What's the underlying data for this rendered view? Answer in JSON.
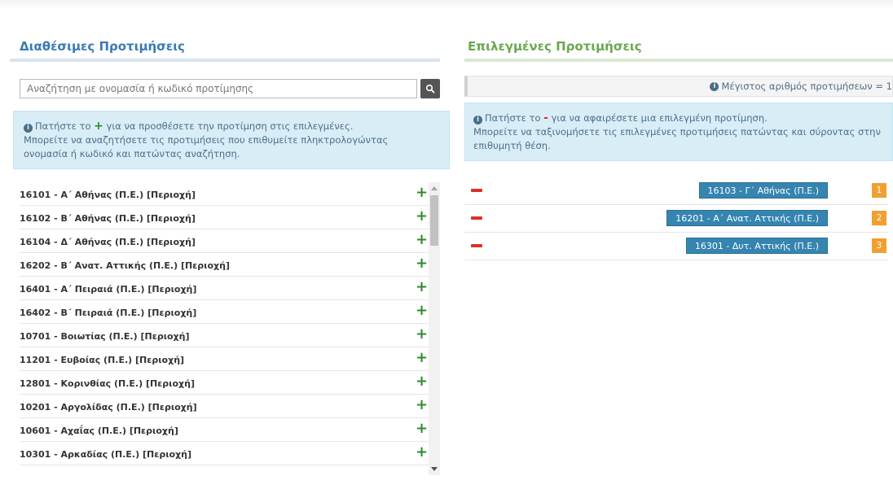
{
  "available": {
    "title": "Διαθέσιμες Προτιμήσεις",
    "search_placeholder": "Αναζήτηση με ονομασία ή κωδικό προτίμησης",
    "info_prefix": "Πατήστε το",
    "info_plus": "+",
    "info_suffix": "για να προσθέσετε την προτίμηση στις επιλεγμένες.",
    "info_line2": "Μπορείτε να αναζητήσετε τις προτιμήσεις που επιθυμείτε πληκτρολογώντας ονομασία ή κωδικό και πατώντας αναζήτηση.",
    "items": [
      "16101 - Α΄ Αθήνας (Π.Ε.) [Περιοχή]",
      "16102 - Β΄ Αθήνας (Π.Ε.) [Περιοχή]",
      "16104 - Δ΄ Αθήνας (Π.Ε.) [Περιοχή]",
      "16202 - Β΄ Ανατ. Αττικής (Π.Ε.) [Περιοχή]",
      "16401 - Α΄ Πειραιά (Π.Ε.) [Περιοχή]",
      "16402 - Β΄ Πειραιά (Π.Ε.) [Περιοχή]",
      "10701 - Βοιωτίας (Π.Ε.) [Περιοχή]",
      "11201 - Ευβοίας (Π.Ε.) [Περιοχή]",
      "12801 - Κορινθίας (Π.Ε.) [Περιοχή]",
      "10201 - Αργολίδας (Π.Ε.) [Περιοχή]",
      "10601 - Αχαΐας (Π.Ε.) [Περιοχή]",
      "10301 - Αρκαδίας (Π.Ε.) [Περιοχή]"
    ],
    "add_symbol": "+"
  },
  "selected": {
    "title": "Επιλεγμένες Προτιμήσεις",
    "max_text": "Μέγιστος αριθμός προτιμήσεων = 1",
    "info_prefix": "Πατήστε το",
    "info_minus": "-",
    "info_suffix": "για να αφαιρέσετε μια επιλεγμένη προτίμηση.",
    "info_line2": "Μπορείτε να ταξινομήσετε τις επιλεγμένες προτιμήσεις πατώντας και σύροντας στην επιθυμητή θέση.",
    "items": [
      {
        "label": "16103 - Γ΄ Αθήνας (Π.Ε.)",
        "rank": "1"
      },
      {
        "label": "16201 - Α΄ Ανατ. Αττικής (Π.Ε.)",
        "rank": "2"
      },
      {
        "label": "16301 - Δυτ. Αττικής (Π.Ε.)",
        "rank": "3"
      }
    ]
  },
  "colors": {
    "available_title": "#3a7ab5",
    "selected_title": "#6aa84f",
    "tag": "#3585b0",
    "rank": "#f0a030",
    "add": "#2e8b2e",
    "remove": "#d9322a"
  }
}
